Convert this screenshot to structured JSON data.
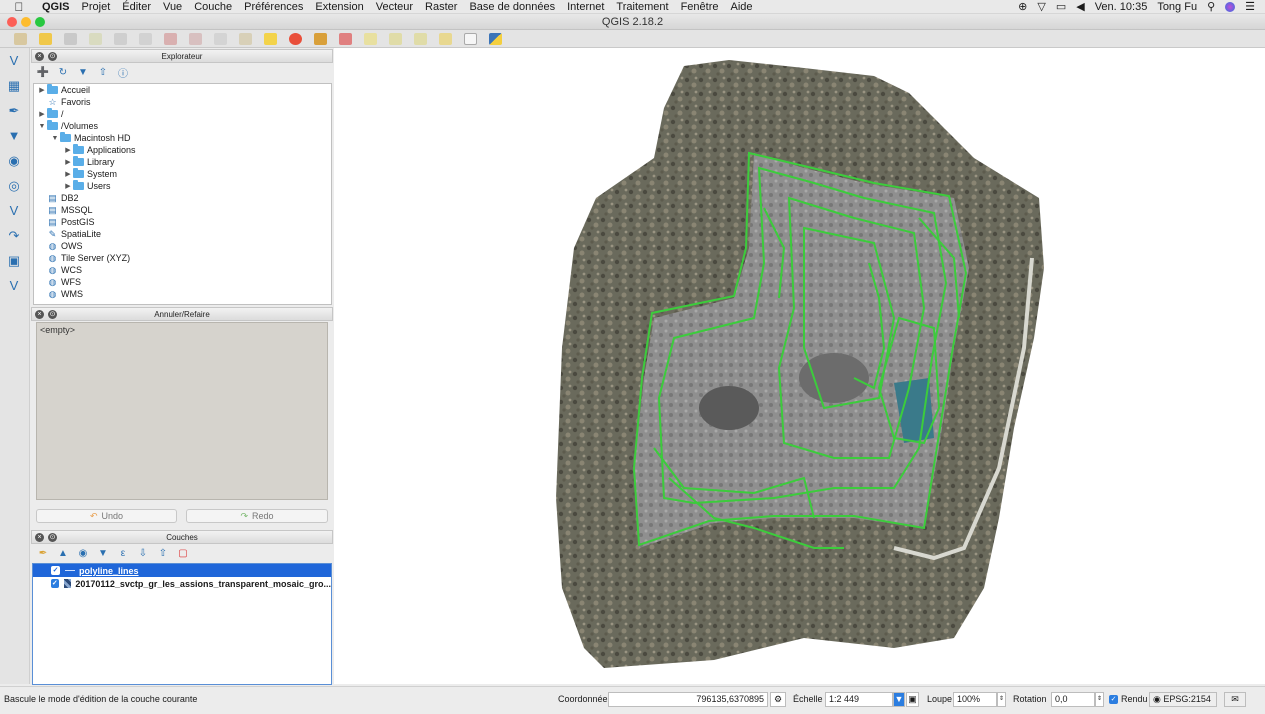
{
  "menubar": {
    "app_name": "QGIS",
    "items": [
      "Projet",
      "Éditer",
      "Vue",
      "Couche",
      "Préférences",
      "Extension",
      "Vecteur",
      "Raster",
      "Base de données",
      "Internet",
      "Traitement",
      "Fenêtre",
      "Aide"
    ],
    "clock": "Ven. 10:35",
    "user": "Tong Fu"
  },
  "window": {
    "title": "QGIS 2.18.2"
  },
  "browser_panel": {
    "title": "Explorateur",
    "tree": [
      {
        "label": "Accueil",
        "expand": "▶",
        "level": 0,
        "icon": "folder"
      },
      {
        "label": "Favoris",
        "expand": "",
        "level": 0,
        "icon": "star"
      },
      {
        "label": "/",
        "expand": "▶",
        "level": 0,
        "icon": "folder"
      },
      {
        "label": "/Volumes",
        "expand": "▼",
        "level": 0,
        "icon": "folder"
      },
      {
        "label": "Macintosh HD",
        "expand": "▼",
        "level": 1,
        "icon": "folder"
      },
      {
        "label": "Applications",
        "expand": "▶",
        "level": 2,
        "icon": "folder"
      },
      {
        "label": "Library",
        "expand": "▶",
        "level": 2,
        "icon": "folder"
      },
      {
        "label": "System",
        "expand": "▶",
        "level": 2,
        "icon": "folder"
      },
      {
        "label": "Users",
        "expand": "▶",
        "level": 2,
        "icon": "folder"
      },
      {
        "label": "DB2",
        "expand": "",
        "level": 0,
        "icon": "db"
      },
      {
        "label": "MSSQL",
        "expand": "",
        "level": 0,
        "icon": "db"
      },
      {
        "label": "PostGIS",
        "expand": "",
        "level": 0,
        "icon": "db"
      },
      {
        "label": "SpatiaLite",
        "expand": "",
        "level": 0,
        "icon": "feather"
      },
      {
        "label": "OWS",
        "expand": "",
        "level": 0,
        "icon": "globe"
      },
      {
        "label": "Tile Server (XYZ)",
        "expand": "",
        "level": 0,
        "icon": "globe"
      },
      {
        "label": "WCS",
        "expand": "",
        "level": 0,
        "icon": "globe"
      },
      {
        "label": "WFS",
        "expand": "",
        "level": 0,
        "icon": "globe"
      },
      {
        "label": "WMS",
        "expand": "",
        "level": 0,
        "icon": "globe"
      }
    ]
  },
  "undo_panel": {
    "title": "Annuler/Refaire",
    "empty_text": "<empty>",
    "undo_label": "Undo",
    "redo_label": "Redo"
  },
  "layers_panel": {
    "title": "Couches",
    "layers": [
      {
        "name": "polyline_lines",
        "checked": true,
        "selected": true,
        "icon": "line"
      },
      {
        "name": "20170112_svctp_gr_les_assions_transparent_mosaic_gro...",
        "checked": true,
        "selected": false,
        "icon": "raster"
      }
    ]
  },
  "statusbar": {
    "message": "Bascule le mode d'édition de la couche courante",
    "coord_label": "Coordonnée",
    "coord_value": "796135,6370895",
    "scale_label": "Échelle",
    "scale_value": "1:2 449",
    "magnifier_label": "Loupe",
    "magnifier_value": "100%",
    "rotation_label": "Rotation",
    "rotation_value": "0,0",
    "render_label": "Rendu",
    "render_checked": true,
    "crs": "EPSG:2154"
  },
  "colors": {
    "selection": "#1f66d9",
    "polyline": "#3ccc3c"
  }
}
